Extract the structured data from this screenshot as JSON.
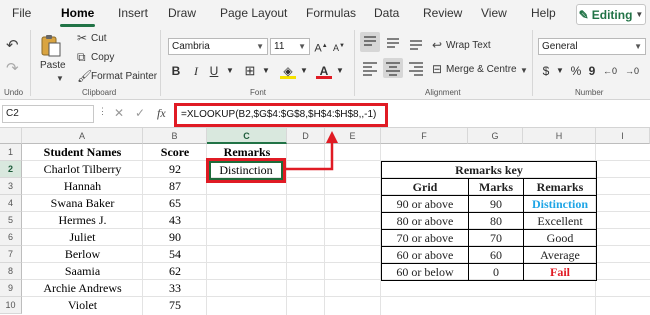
{
  "menu": {
    "tabs": [
      "File",
      "Home",
      "Insert",
      "Draw",
      "Page Layout",
      "Formulas",
      "Data",
      "Review",
      "View",
      "Help"
    ],
    "active": "Home",
    "editing": "Editing"
  },
  "ribbon": {
    "undo_label": "Undo",
    "clipboard": {
      "paste": "Paste",
      "cut": "Cut",
      "copy": "Copy",
      "format_painter": "Format Painter",
      "label": "Clipboard"
    },
    "font": {
      "name": "Cambria",
      "size": "11",
      "label": "Font"
    },
    "alignment": {
      "wrap": "Wrap Text",
      "merge": "Merge & Centre",
      "label": "Alignment"
    },
    "number": {
      "format": "General",
      "label": "Number"
    }
  },
  "formula_bar": {
    "name_box": "C2",
    "fx": "fx",
    "formula": "=XLOOKUP(B2,$G$4:$G$8,$H$4:$H$8,,-1)"
  },
  "sheet": {
    "columns": [
      "A",
      "B",
      "C",
      "D",
      "E",
      "F",
      "G",
      "H",
      "I"
    ],
    "rows": [
      "1",
      "2",
      "3",
      "4",
      "5",
      "6",
      "7",
      "8",
      "9",
      "10"
    ],
    "header_names": "Student Names",
    "header_score": "Score",
    "header_remarks": "Remarks",
    "students": [
      {
        "name": "Charlot Tilberry",
        "score": "92"
      },
      {
        "name": "Hannah",
        "score": "87"
      },
      {
        "name": "Swana Baker",
        "score": "65"
      },
      {
        "name": "Hermes J.",
        "score": "43"
      },
      {
        "name": "Juliet",
        "score": "90"
      },
      {
        "name": "Berlow",
        "score": "54"
      },
      {
        "name": "Saamia",
        "score": "62"
      },
      {
        "name": "Archie Andrews",
        "score": "33"
      },
      {
        "name": "Violet",
        "score": "75"
      }
    ],
    "c2_value": "Distinction"
  },
  "remarks_key": {
    "title": "Remarks key",
    "headers": [
      "Grid",
      "Marks",
      "Remarks"
    ],
    "rows": [
      {
        "grid": "90 or above",
        "marks": "90",
        "remark": "Distinction",
        "color": "#1ea5e6"
      },
      {
        "grid": "80 or above",
        "marks": "80",
        "remark": "Excellent",
        "color": "#000000"
      },
      {
        "grid": "70 or above",
        "marks": "70",
        "remark": "Good",
        "color": "#000000"
      },
      {
        "grid": "60 or above",
        "marks": "60",
        "remark": "Average",
        "color": "#000000"
      },
      {
        "grid": "60 or below",
        "marks": "0",
        "remark": "Fail",
        "color": "#e01b24"
      }
    ]
  },
  "colors": {
    "accent": "#217346",
    "highlight": "#e01b24"
  }
}
